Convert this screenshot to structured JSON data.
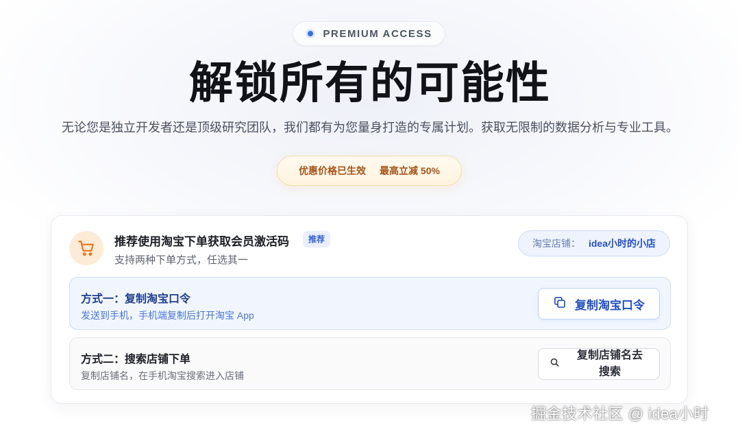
{
  "header": {
    "pill_label": "PREMIUM ACCESS",
    "headline": "解锁所有的可能性",
    "subtitle": "无论您是独立开发者还是顶级研究团队，我们都有为您量身打造的专属计划。获取无限制的数据分析与专业工具。"
  },
  "promo": {
    "status": "优惠价格已生效",
    "discount": "最高立减 50%"
  },
  "card": {
    "title": "推荐使用淘宝下单获取会员激活码",
    "badge": "推荐",
    "subtitle": "支持两种下单方式，任选其一",
    "store_label": "淘宝店铺：",
    "store_name": "idea小时的小店",
    "icon": "cart-icon",
    "methods": [
      {
        "title": "方式一：复制淘宝口令",
        "description": "发送到手机，手机端复制后打开淘宝 App",
        "button_label": "复制淘宝口令",
        "button_icon": "copy-icon"
      },
      {
        "title": "方式二：搜索店铺下单",
        "description": "复制店铺名，在手机淘宝搜索进入店铺",
        "button_label": "复制店铺名去搜索",
        "button_icon": "search-icon"
      }
    ]
  },
  "watermark": "掘金技术社区 @ idea小时",
  "colors": {
    "accent_blue": "#2350c0",
    "promo_text": "#a5541a",
    "cart_bg": "#fdebd7",
    "cart_icon": "#e8761e"
  }
}
